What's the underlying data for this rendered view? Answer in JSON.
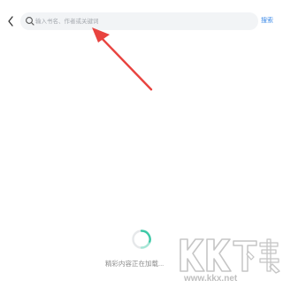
{
  "header": {
    "back_icon": "chevron-left-icon",
    "search": {
      "icon": "search-icon",
      "placeholder": "输入书名、作者或关键词",
      "value": ""
    },
    "search_button_label": "搜索"
  },
  "loading": {
    "spinner_icon": "loading-spinner-icon",
    "text": "精彩内容正在加载..."
  },
  "watermark": {
    "logo_text": "KK下载",
    "url": "www.kkx.net"
  },
  "colors": {
    "accent": "#3e8be8",
    "search_bg": "#f2f4f6",
    "spinner": "#3cc9a6",
    "arrow": "#e8433f"
  }
}
